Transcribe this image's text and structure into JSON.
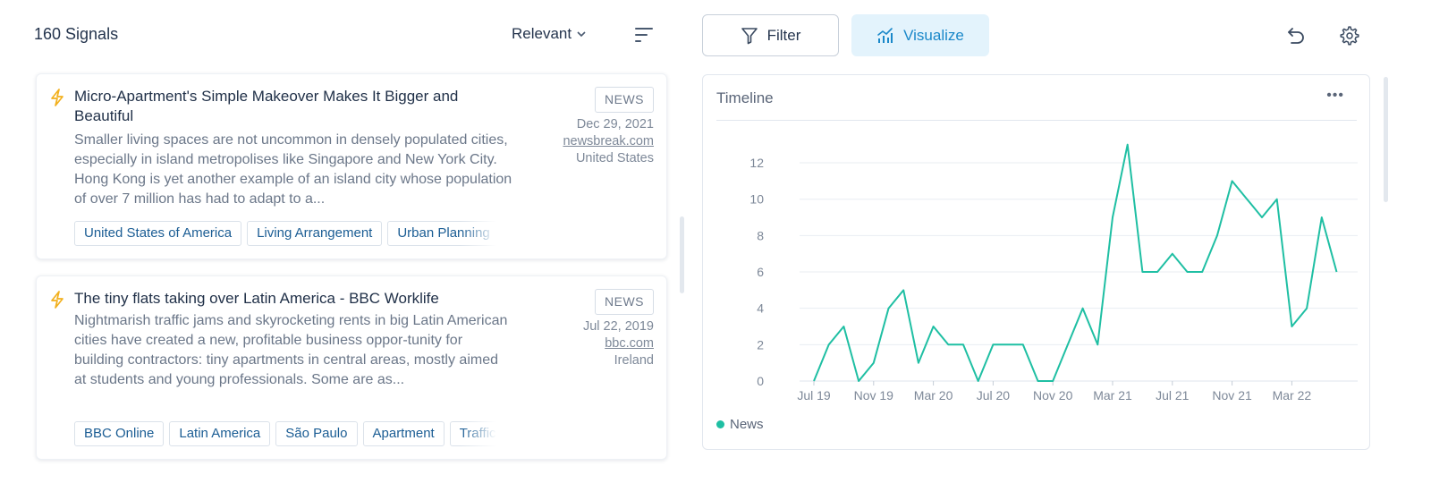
{
  "header": {
    "signals_count": "160 Signals",
    "sort_label": "Relevant",
    "filter_label": "Filter",
    "visualize_label": "Visualize",
    "icons": {
      "sort_chevron": "chevron-down-icon",
      "sort_order": "sort-lines-icon",
      "filter": "funnel-icon",
      "visualize": "chart-bars-trend-icon",
      "undo": "undo-icon",
      "settings": "gear-icon"
    }
  },
  "signals": [
    {
      "icon": "lightning-bolt-icon",
      "title": "Micro-Apartment's Simple Makeover Makes It Bigger and Beautiful",
      "summary": "Smaller living spaces are not uncommon in densely populated cities, especially in island metropolises like Singapore and New York City. Hong Kong is yet another example of an island city whose population of over 7 million has had to adapt to a...",
      "type": "NEWS",
      "date": "Dec 29, 2021",
      "source": "newsbreak.com",
      "country": "United States",
      "tags": [
        "United States of America",
        "Living Arrangement",
        "Urban Planning"
      ]
    },
    {
      "icon": "lightning-bolt-icon",
      "title": "The tiny flats taking over Latin America - BBC Worklife",
      "summary": "Nightmarish traffic jams and skyrocketing rents in big Latin American cities have created a new, profitable business oppor-tunity for building contractors: tiny apartments in central areas, mostly aimed at students and young professionals. Some are as...",
      "type": "NEWS",
      "date": "Jul 22, 2019",
      "source": "bbc.com",
      "country": "Ireland",
      "tags": [
        "BBC Online",
        "Latin America",
        "São Paulo",
        "Apartment",
        "Traffic Co"
      ]
    }
  ],
  "timeline": {
    "title": "Timeline",
    "more_label": "•••",
    "legend_label": "News",
    "series_color": "#1fbfa3"
  },
  "chart_data": {
    "type": "line",
    "title": "Timeline",
    "xlabel": "",
    "ylabel": "",
    "ylim": [
      0,
      13
    ],
    "yticks": [
      0,
      2,
      4,
      6,
      8,
      10,
      12
    ],
    "grid": true,
    "legend": "bottom-left",
    "x_tick_labels": [
      "Jul 19",
      "Nov 19",
      "Mar 20",
      "Jul 20",
      "Nov 20",
      "Mar 21",
      "Jul 21",
      "Nov 21",
      "Mar 22"
    ],
    "x_tick_indices": [
      0,
      4,
      8,
      12,
      16,
      20,
      24,
      28,
      32
    ],
    "x": [
      "2019-07",
      "2019-08",
      "2019-09",
      "2019-10",
      "2019-11",
      "2019-12",
      "2020-01",
      "2020-02",
      "2020-03",
      "2020-04",
      "2020-05",
      "2020-06",
      "2020-07",
      "2020-08",
      "2020-09",
      "2020-10",
      "2020-11",
      "2020-12",
      "2021-01",
      "2021-02",
      "2021-03",
      "2021-04",
      "2021-05",
      "2021-06",
      "2021-07",
      "2021-08",
      "2021-09",
      "2021-10",
      "2021-11",
      "2021-12",
      "2022-01",
      "2022-02",
      "2022-03",
      "2022-04",
      "2022-05",
      "2022-06"
    ],
    "series": [
      {
        "name": "News",
        "values": [
          0,
          2,
          3,
          0,
          1,
          4,
          5,
          1,
          3,
          2,
          2,
          0,
          2,
          2,
          2,
          0,
          0,
          2,
          4,
          2,
          9,
          13,
          6,
          6,
          7,
          6,
          6,
          8,
          11,
          10,
          9,
          10,
          3,
          4,
          9,
          6
        ]
      }
    ]
  }
}
